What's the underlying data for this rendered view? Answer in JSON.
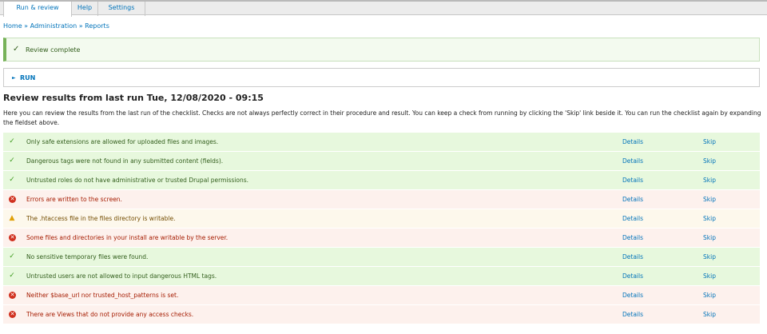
{
  "tabs": [
    {
      "label": "Run & review",
      "active": true
    },
    {
      "label": "Help",
      "active": false
    },
    {
      "label": "Settings",
      "active": false
    }
  ],
  "breadcrumb": [
    "Home",
    "Administration",
    "Reports"
  ],
  "breadcrumb_sep": "»",
  "message": {
    "text": "Review complete",
    "icon": "check-icon"
  },
  "fieldset": {
    "label": "RUN"
  },
  "heading": "Review results from last run Tue, 12/08/2020 - 09:15",
  "description": "Here you can review the results from the last run of the checklist. Checks are not always perfectly correct in their procedure and result. You can keep a check from running by clicking the 'Skip' link beside it. You can run the checklist again by expanding the fieldset above.",
  "rows": [
    {
      "status": "success",
      "icon": "check-icon",
      "message": "Only safe extensions are allowed for uploaded files and images.",
      "details": "Details",
      "skip": "Skip"
    },
    {
      "status": "success",
      "icon": "check-icon",
      "message": "Dangerous tags were not found in any submitted content (fields).",
      "details": "Details",
      "skip": "Skip"
    },
    {
      "status": "success",
      "icon": "check-icon",
      "message": "Untrusted roles do not have administrative or trusted Drupal permissions.",
      "details": "Details",
      "skip": "Skip"
    },
    {
      "status": "error",
      "icon": "error-icon",
      "message": "Errors are written to the screen.",
      "details": "Details",
      "skip": "Skip"
    },
    {
      "status": "warning",
      "icon": "warning-icon",
      "message": "The .htaccess file in the files directory is writable.",
      "details": "Details",
      "skip": "Skip"
    },
    {
      "status": "error",
      "icon": "error-icon",
      "message": "Some files and directories in your install are writable by the server.",
      "details": "Details",
      "skip": "Skip"
    },
    {
      "status": "success",
      "icon": "check-icon",
      "message": "No sensitive temporary files were found.",
      "details": "Details",
      "skip": "Skip"
    },
    {
      "status": "success",
      "icon": "check-icon",
      "message": "Untrusted users are not allowed to input dangerous HTML tags.",
      "details": "Details",
      "skip": "Skip"
    },
    {
      "status": "error",
      "icon": "error-icon",
      "message": "Neither $base_url nor trusted_host_patterns is set.",
      "details": "Details",
      "skip": "Skip"
    },
    {
      "status": "error",
      "icon": "error-icon",
      "message": "There are Views that do not provide any access checks.",
      "details": "Details",
      "skip": "Skip"
    }
  ],
  "colors": {
    "link": "#0073ba",
    "success_bg": "#e7f8dd",
    "error_bg": "#fdf1ed",
    "warning_bg": "#fdf8ec"
  }
}
